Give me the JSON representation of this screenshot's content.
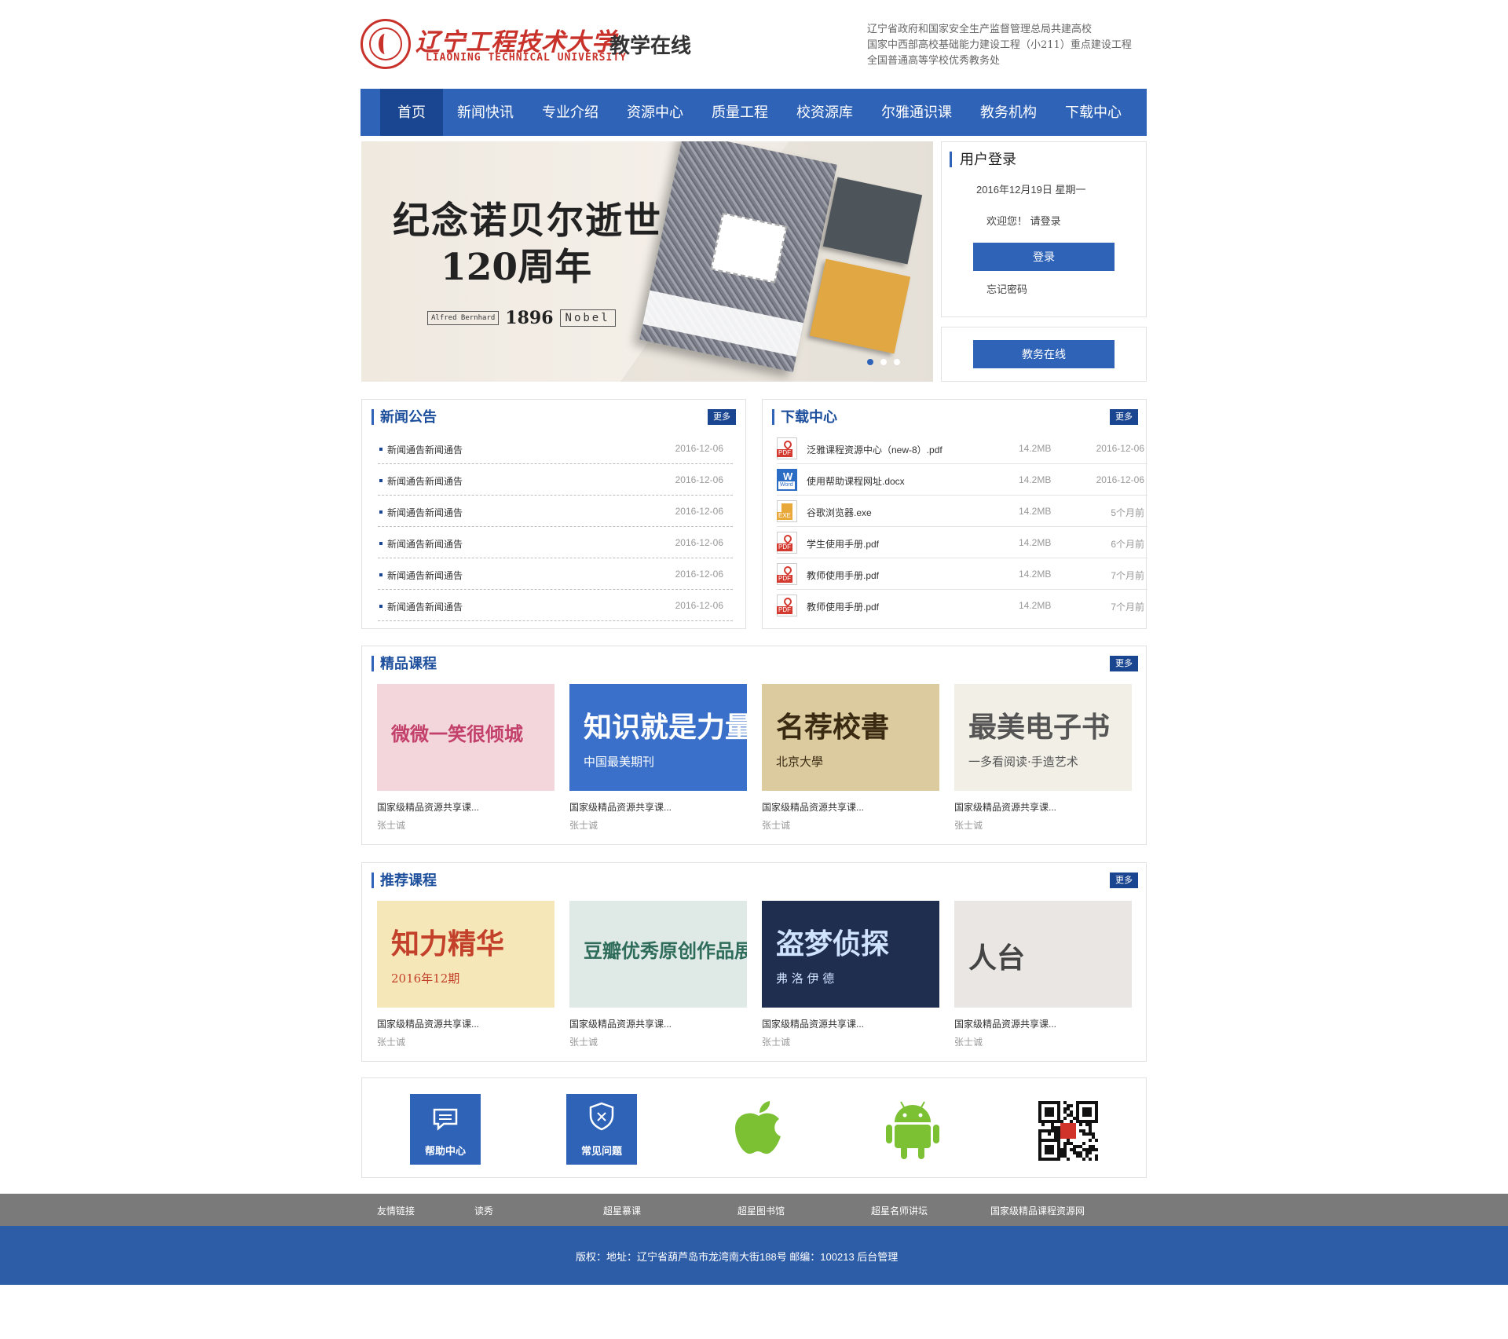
{
  "header": {
    "logo_cn": "辽宁工程技术大学",
    "logo_en": "LIAONING TECHNICAL UNIVERSITY",
    "subtitle": "教学在线",
    "notes": [
      "辽宁省政府和国家安全生产监督管理总局共建高校",
      "国家中西部高校基础能力建设工程（小211）重点建设工程",
      "全国普通高等学校优秀教务处"
    ]
  },
  "nav": [
    "首页",
    "新闻快讯",
    "专业介绍",
    "资源中心",
    "质量工程",
    "校资源库",
    "尔雅通识课",
    "教务机构",
    "下载中心"
  ],
  "banner": {
    "title": "纪念诺贝尔逝世",
    "title2": "120周年",
    "tag_name": "Alfred Bernhard",
    "tag_year": "1896",
    "tag_word": "Nobel"
  },
  "login": {
    "title": "用户登录",
    "date": "2016年12月19日 星期一",
    "welcome": "欢迎您！ 请登录",
    "login_button": "登录",
    "forgot": "忘记密码",
    "office_button": "教务在线"
  },
  "news": {
    "title": "新闻公告",
    "more": "更多",
    "items": [
      {
        "title": "新闻通告新闻通告",
        "date": "2016-12-06"
      },
      {
        "title": "新闻通告新闻通告",
        "date": "2016-12-06"
      },
      {
        "title": "新闻通告新闻通告",
        "date": "2016-12-06"
      },
      {
        "title": "新闻通告新闻通告",
        "date": "2016-12-06"
      },
      {
        "title": "新闻通告新闻通告",
        "date": "2016-12-06"
      },
      {
        "title": "新闻通告新闻通告",
        "date": "2016-12-06"
      }
    ]
  },
  "downloads": {
    "title": "下载中心",
    "more": "更多",
    "items": [
      {
        "icon": "pdf",
        "tag": "PDF",
        "name": "泛雅课程资源中心（new-8）.pdf",
        "size": "14.2MB",
        "date": "2016-12-06"
      },
      {
        "icon": "word",
        "tag": "Word",
        "name": "使用帮助课程网址.docx",
        "size": "14.2MB",
        "date": "2016-12-06"
      },
      {
        "icon": "exe",
        "tag": "EXE",
        "name": "谷歌浏览器.exe",
        "size": "14.2MB",
        "date": "5个月前"
      },
      {
        "icon": "pdf",
        "tag": "PDF",
        "name": "学生使用手册.pdf",
        "size": "14.2MB",
        "date": "6个月前"
      },
      {
        "icon": "pdf",
        "tag": "PDF",
        "name": "教师使用手册.pdf",
        "size": "14.2MB",
        "date": "7个月前"
      },
      {
        "icon": "pdf",
        "tag": "PDF",
        "name": "教师使用手册.pdf",
        "size": "14.2MB",
        "date": "7个月前"
      }
    ]
  },
  "featured": {
    "title": "精品课程",
    "more": "更多",
    "cards": [
      {
        "title": "国家级精品资源共享课...",
        "author": "张士诚",
        "thumb": "微微一笑很倾城",
        "sub": "",
        "color": "#f3d6dc",
        "ink": "#c2406a"
      },
      {
        "title": "国家级精品资源共享课...",
        "author": "张士诚",
        "thumb": "知识就是力量",
        "sub": "中国最美期刊",
        "color": "#3a70c9",
        "ink": "#ffffff"
      },
      {
        "title": "国家级精品资源共享课...",
        "author": "张士诚",
        "thumb": "名荐校書",
        "sub": "北京大學",
        "color": "#dccb9f",
        "ink": "#3a2a12"
      },
      {
        "title": "国家级精品资源共享课...",
        "author": "张士诚",
        "thumb": "最美电子书",
        "sub": "一多看阅读·手造艺术",
        "color": "#f1efe6",
        "ink": "#555555"
      }
    ]
  },
  "recommended": {
    "title": "推荐课程",
    "more": "更多",
    "cards": [
      {
        "title": "国家级精品资源共享课...",
        "author": "张士诚",
        "thumb": "知力精华",
        "sub": "2016年12期",
        "color": "#f6e7b8",
        "ink": "#c3402a"
      },
      {
        "title": "国家级精品资源共享课...",
        "author": "张士诚",
        "thumb": "豆瓣优秀原创作品展",
        "sub": "",
        "color": "#dfeae6",
        "ink": "#2f6d5a"
      },
      {
        "title": "国家级精品资源共享课...",
        "author": "张士诚",
        "thumb": "盗梦侦探",
        "sub": "弗 洛 伊 德",
        "color": "#1f2d4f",
        "ink": "#cfe3ff"
      },
      {
        "title": "国家级精品资源共享课...",
        "author": "张士诚",
        "thumb": "人台",
        "sub": "",
        "color": "#e9e6e3",
        "ink": "#444444"
      }
    ]
  },
  "bottom": {
    "help": "帮助中心",
    "faq": "常见问题"
  },
  "links": {
    "label": "友情链接",
    "items": [
      "读秀",
      "超星慕课",
      "超星图书馆",
      "超星名师讲坛",
      "国家级精品课程资源网"
    ]
  },
  "footer": {
    "copyright": "版权：地址：辽宁省葫芦岛市龙湾南大街188号  邮编：100213  后台管理"
  }
}
